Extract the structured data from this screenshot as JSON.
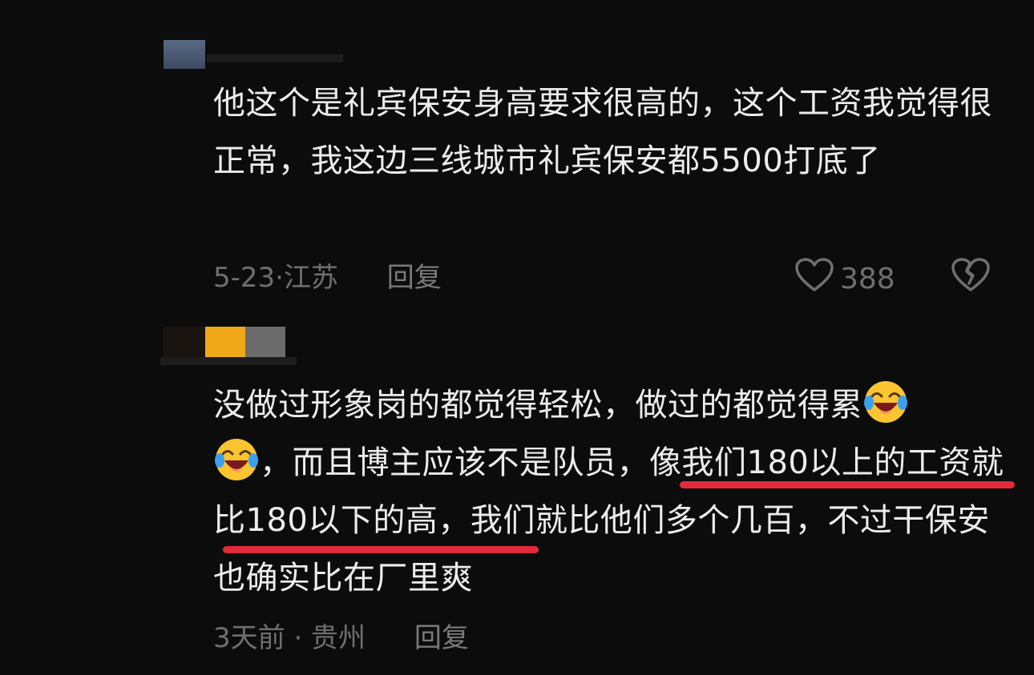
{
  "comments": [
    {
      "text": "他这个是礼宾保安身高要求很高的，这个工资我觉得很正常，我这边三线城市礼宾保安都5500打底了",
      "date_location": "5-23·江苏",
      "reply_label": "回复",
      "like_count": "388"
    },
    {
      "text_part1": "没做过形象岗的都觉得轻松，做过的都觉得累",
      "text_part2": "，而且博主应该不是队员，",
      "text_highlight": "像我们180以上的工资就比180以下的高",
      "text_part3": "，我们就比他们多个几百，不过干保安也确实比在厂里爽",
      "date_location": "3天前 · 贵州",
      "reply_label": "回复"
    }
  ],
  "colors": {
    "background": "#0c0c0c",
    "text": "#ececec",
    "meta": "#6f6f6f",
    "highlight_underline": "#e32a3a"
  },
  "icons": {
    "like": "heart-outline-icon",
    "dislike": "broken-heart-icon",
    "emoji": "laughing-crying-emoji"
  }
}
